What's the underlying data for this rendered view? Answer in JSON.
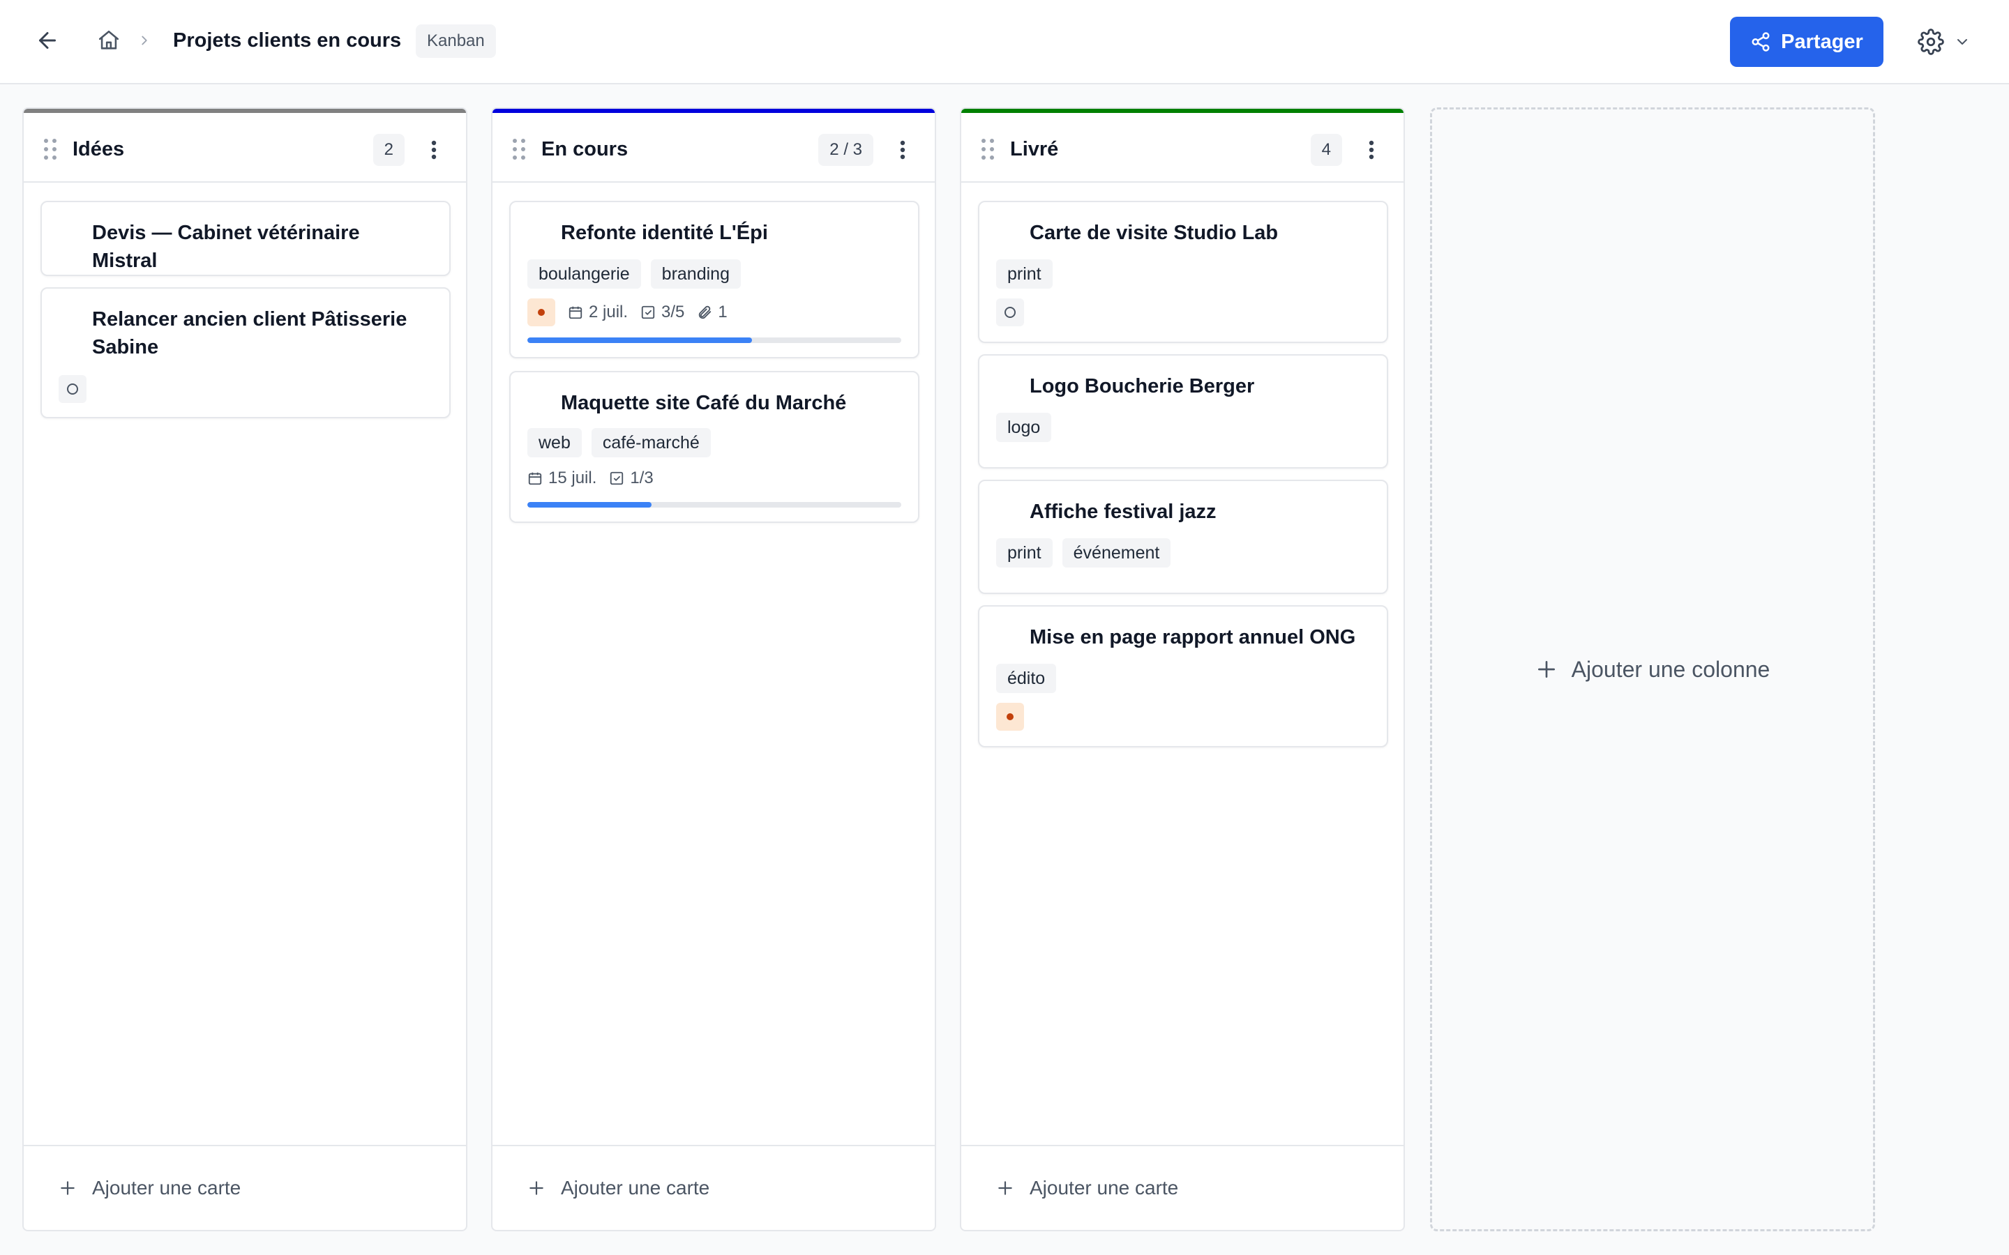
{
  "header": {
    "breadcrumb_title": "Projets clients en cours",
    "view_badge": "Kanban",
    "share_label": "Partager",
    "icons": [
      "arrow-left-icon",
      "home-icon",
      "chevron-right-icon",
      "share-icon",
      "gear-icon",
      "chevron-down-icon"
    ]
  },
  "colors": {
    "accent": "#2563eb",
    "column_ideas": "#808080",
    "column_in_progress": "#0000dd",
    "column_delivered": "#008000",
    "progress": "#3b82f6",
    "priority_high_bg": "#fde7d3",
    "priority_high_dot": "#c2410c"
  },
  "columns": [
    {
      "title": "Idées",
      "count": "2",
      "add_card_label": "Ajouter une carte",
      "cards": [
        {
          "title": "Devis — Cabinet vétérinaire Mistral"
        },
        {
          "title": "Relancer ancien client Pâtisserie Sabine",
          "priority": "none"
        }
      ]
    },
    {
      "title": "En cours",
      "count": "2 / 3",
      "add_card_label": "Ajouter une carte",
      "cards": [
        {
          "title": "Refonte identité L'Épi",
          "tags": [
            "boulangerie",
            "branding"
          ],
          "priority": "high",
          "due": "2 juil.",
          "checklist": "3/5",
          "attachments": "1",
          "progress": 0.6
        },
        {
          "title": "Maquette site Café du Marché",
          "tags": [
            "web",
            "café-marché"
          ],
          "due": "15 juil.",
          "checklist": "1/3",
          "progress": 0.333
        }
      ]
    },
    {
      "title": "Livré",
      "count": "4",
      "add_card_label": "Ajouter une carte",
      "cards": [
        {
          "title": "Carte de visite Studio Lab",
          "tags": [
            "print"
          ],
          "priority": "none"
        },
        {
          "title": "Logo Boucherie Berger",
          "tags": [
            "logo"
          ]
        },
        {
          "title": "Affiche festival jazz",
          "tags": [
            "print",
            "événement"
          ]
        },
        {
          "title": "Mise en page rapport annuel ONG",
          "tags": [
            "édito"
          ],
          "priority": "high"
        }
      ]
    }
  ],
  "add_column_label": "Ajouter une colonne"
}
